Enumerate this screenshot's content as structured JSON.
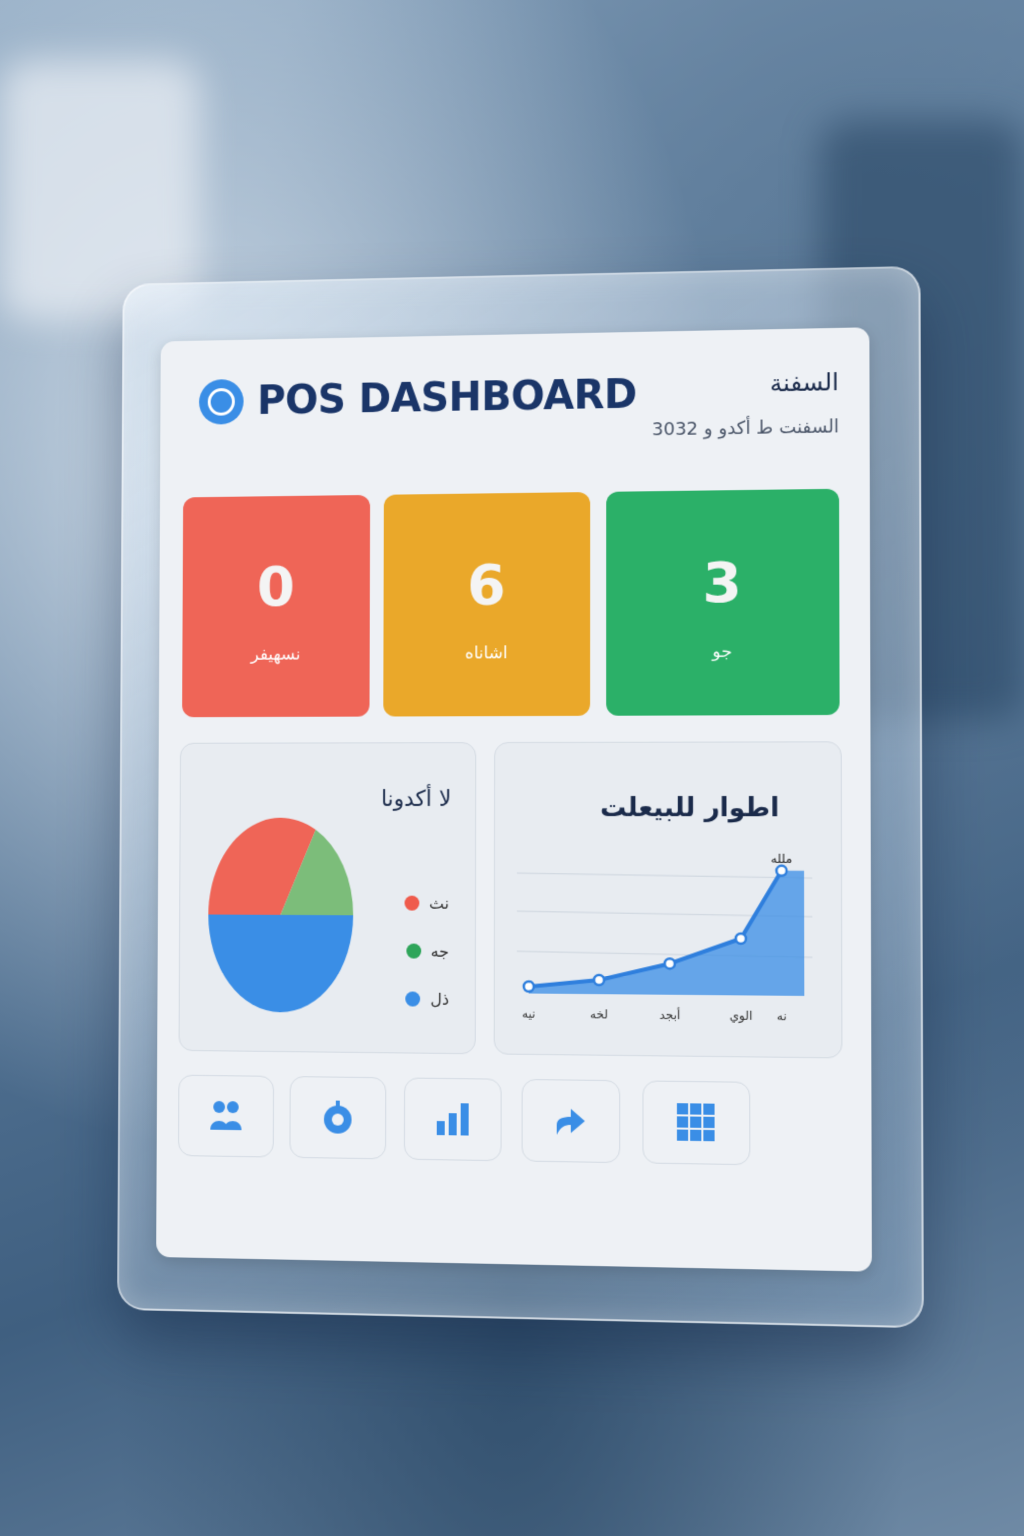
{
  "app": {
    "title": "POS DASHBOARD",
    "logo_icon": "logo-icon"
  },
  "header": {
    "title_right": "السفنة",
    "subtitle_right": "السفنت ط أكدو و 3032"
  },
  "stats": [
    {
      "value": "0",
      "label": "نسهيفر",
      "color": "#ef6557"
    },
    {
      "value": "6",
      "label": "اشاناه",
      "color": "#eaa82a"
    },
    {
      "value": "3",
      "label": "جو",
      "color": "#2bb068"
    }
  ],
  "pie_card": {
    "title": "لا أكدونا",
    "legend": [
      {
        "label": "نث",
        "color": "#ef5b4c"
      },
      {
        "label": "جه",
        "color": "#2ea55a"
      },
      {
        "label": "ذل",
        "color": "#3a8ee6"
      }
    ]
  },
  "line_card": {
    "title": "اطوار للبيعلت"
  },
  "nav": [
    {
      "icon": "users-icon"
    },
    {
      "icon": "coin-icon"
    },
    {
      "icon": "bar-chart-icon"
    },
    {
      "icon": "return-arrow-icon"
    },
    {
      "icon": "grid-icon"
    }
  ],
  "chart_data": [
    {
      "type": "pie",
      "title": "لا أكدونا",
      "slices": [
        {
          "label": "نث",
          "value": 33,
          "color": "#ef6557"
        },
        {
          "label": "جه",
          "value": 17,
          "color": "#7cbd7a"
        },
        {
          "label": "ذل",
          "value": 50,
          "color": "#3a8ee6"
        }
      ]
    },
    {
      "type": "area",
      "title": "اطوار للبيعلت",
      "categories": [
        "نيه",
        "لخه",
        "أبجد",
        "الوي",
        "نه"
      ],
      "values": [
        5,
        10,
        22,
        40,
        88
      ],
      "peak_label": "ملله",
      "ylim": [
        0,
        100
      ],
      "grid": true,
      "color": "#3a8ee6"
    }
  ]
}
